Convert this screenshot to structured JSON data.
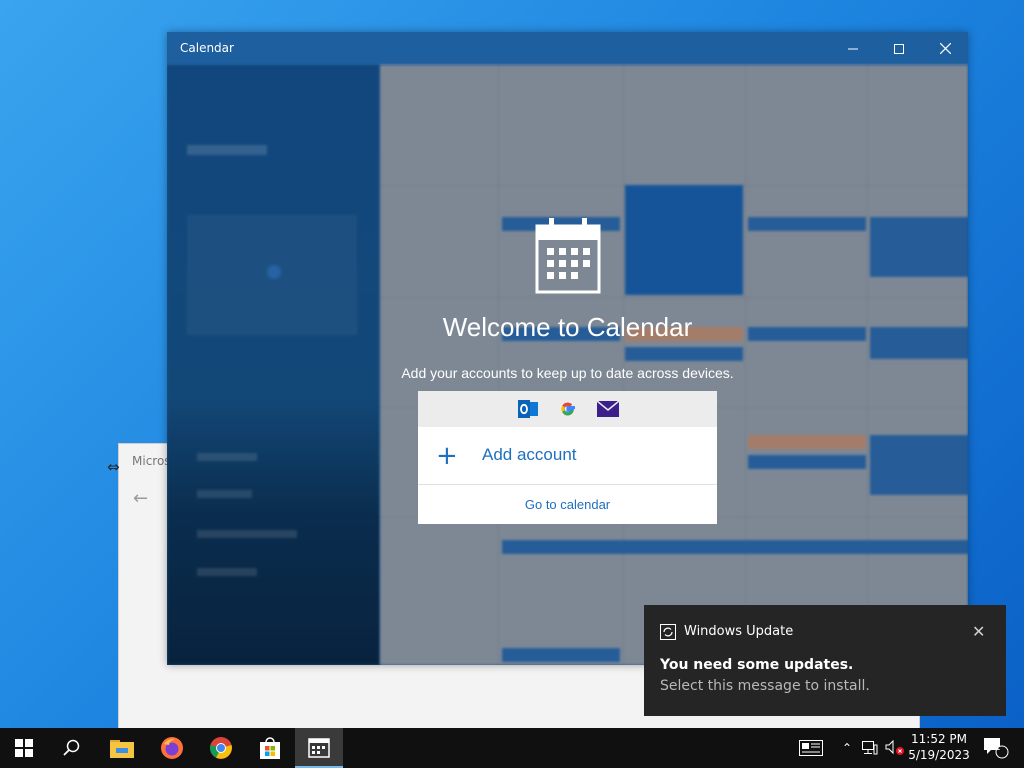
{
  "background_window": {
    "title": "Micros"
  },
  "calendar_window": {
    "title": "Calendar",
    "welcome_title": "Welcome to Calendar",
    "welcome_subtitle": "Add your accounts to keep up to date across devices.",
    "providers": [
      "outlook-icon",
      "google-icon",
      "mail-icon"
    ],
    "add_account_label": "Add account",
    "go_to_calendar_label": "Go to calendar"
  },
  "toast": {
    "app_name": "Windows Update",
    "heading": "You need some updates.",
    "body": "Select this message to install."
  },
  "taskbar": {
    "time": "11:52 PM",
    "date": "5/19/2023",
    "notification_count": "1"
  },
  "colors": {
    "accent": "#1f6fc0",
    "calendar_titlebar": "#1e5f9f",
    "taskbar": "#101010",
    "toast": "#252525"
  }
}
